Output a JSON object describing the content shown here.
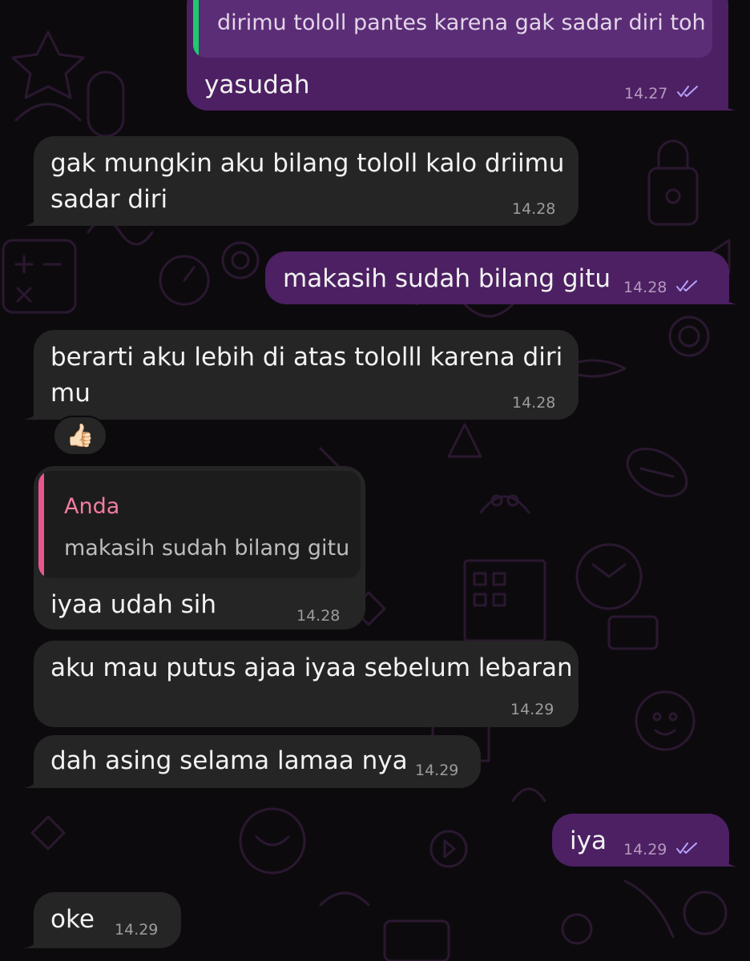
{
  "colors": {
    "background": "#0d0a0e",
    "incoming_bubble": "#252525",
    "outgoing_bubble": "#4c2062",
    "quote_bar_green": "#1fca6f",
    "quote_bar_pink": "#e9568f",
    "quote_author_pink": "#f47ca0",
    "read_ticks": "#b7a1ff"
  },
  "messages": {
    "m1": {
      "direction": "outgoing",
      "quote_text": "dirimu tololl pantes karena gak sadar diri toh",
      "text": "yasudah",
      "time": "14.27",
      "status": "read"
    },
    "m2": {
      "direction": "incoming",
      "line1": "gak mungkin aku bilang tololl kalo driimu",
      "line2": "sadar diri",
      "time": "14.28"
    },
    "m3": {
      "direction": "outgoing",
      "text": "makasih sudah bilang gitu",
      "time": "14.28",
      "status": "read"
    },
    "m4": {
      "direction": "incoming",
      "line1": "berarti aku lebih di atas tololll karena diri",
      "line2": "mu",
      "time": "14.28",
      "reaction": "👍🏻"
    },
    "m5": {
      "direction": "incoming",
      "quote_author": "Anda",
      "quote_text": "makasih sudah bilang gitu",
      "text": "iyaa udah sih",
      "time": "14.28"
    },
    "m6": {
      "direction": "incoming",
      "text": "aku mau putus ajaa iyaa sebelum lebaran",
      "time": "14.29"
    },
    "m7": {
      "direction": "incoming",
      "text": "dah asing selama lamaa nya",
      "time": "14.29"
    },
    "m8": {
      "direction": "outgoing",
      "text": "iya",
      "time": "14.29",
      "status": "read"
    },
    "m9": {
      "direction": "incoming",
      "text": "oke",
      "time": "14.29"
    }
  },
  "icons": {
    "read_receipt": "double-check-icon",
    "reaction": "thumbs-up-emoji"
  }
}
